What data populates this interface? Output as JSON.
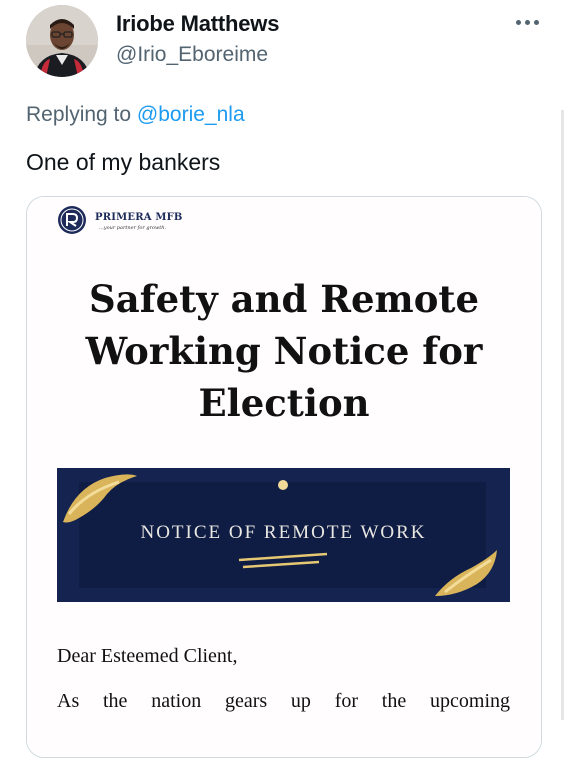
{
  "tweet": {
    "author": {
      "display_name": "Iriobe Matthews",
      "handle": "@Irio_Eboreime",
      "avatar_icon": "profile-photo"
    },
    "more_icon": "ellipsis-icon",
    "reply_context": {
      "prefix": "Replying to ",
      "mention": "@borie_nla"
    },
    "text": "One of my bankers",
    "colors": {
      "text": "#0f1419",
      "secondary": "#536471",
      "link": "#1d9bf0"
    }
  },
  "flyer": {
    "brand_name": "PRIMERA MFB",
    "brand_tagline": "...your partner for growth.",
    "headline_lines": [
      "Safety and Remote",
      "Working Notice for",
      "Election"
    ],
    "banner_title": "NOTICE OF REMOTE WORK",
    "greeting": "Dear Esteemed Client,",
    "body_first_line": "As the nation gears up for the upcoming",
    "colors": {
      "banner": "#14234f",
      "gold": "#d9b45a"
    }
  }
}
